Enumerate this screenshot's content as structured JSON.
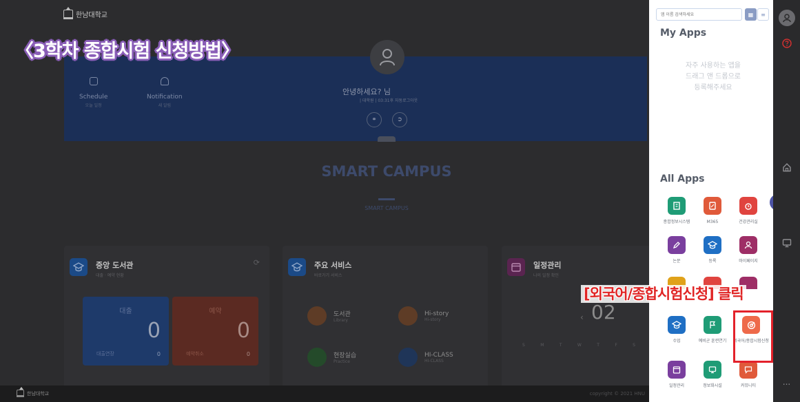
{
  "overlay": {
    "title": "〈3학차 종합시험 신청방법〉",
    "callout": "[외국어/종합시험신청] 클릭"
  },
  "header": {
    "logo_text": "한남대학교"
  },
  "hero": {
    "schedule_label": "Schedule",
    "schedule_sub": "오늘 일정",
    "notification_label": "Notification",
    "notification_sub": "새 알림",
    "greeting": "안녕하세요?         님",
    "greeting_sub": "| 대학원 | 03:31후 자동로그아웃"
  },
  "smart_campus": {
    "title": "SMART CAMPUS",
    "subtitle": "SMART CAMPUS"
  },
  "cards": {
    "library": {
      "title": "중앙 도서관",
      "subtitle": "대출 · 예약 현황",
      "loan_label": "대출",
      "loan_count": "0",
      "loan_foot_label": "대출연장",
      "loan_foot_value": "0",
      "reserve_label": "예약",
      "reserve_count": "0",
      "reserve_foot_label": "예약취소",
      "reserve_foot_value": "0"
    },
    "services": {
      "title": "주요 서비스",
      "subtitle": "바로가기 서비스",
      "items": [
        {
          "label": "도서관",
          "sub": "Library"
        },
        {
          "label": "Hi-story",
          "sub": "Hi-story"
        },
        {
          "label": "현장실습",
          "sub": "Practice"
        },
        {
          "label": "HI-CLASS",
          "sub": "HI-CLASS"
        }
      ]
    },
    "calendar": {
      "title": "일정관리",
      "subtitle": "나의 일정 확인",
      "big_date": "02",
      "weekdays": [
        "S",
        "M",
        "T",
        "W",
        "T",
        "F",
        "S"
      ]
    }
  },
  "footer": {
    "logo_text": "한남대학교",
    "copyright": "copyright © 2021 HNU"
  },
  "panel": {
    "search_placeholder": "앱 이름 검색하세요",
    "my_apps_title": "My Apps",
    "empty_line1": "자주 사용하는 앱을",
    "empty_line2": "드래그 앤 드롭으로",
    "empty_line3": "등록해주세요",
    "all_apps_title": "All Apps",
    "apps": [
      {
        "label": "종합정보시스템",
        "color": "#1f9c76",
        "icon": "building-icon"
      },
      {
        "label": "M365",
        "color": "#e05a3a",
        "icon": "document-icon"
      },
      {
        "label": "건강관리실",
        "color": "#e0443f",
        "icon": "alarm-clock-icon"
      },
      {
        "label": "논문",
        "color": "#7a3f9e",
        "icon": "pencil-icon"
      },
      {
        "label": "등록",
        "color": "#1f6fc4",
        "icon": "graduation-cap-icon"
      },
      {
        "label": "마이페이지",
        "color": "#9e2e66",
        "icon": "person-icon"
      },
      {
        "label": "수업",
        "color": "#1f6fc4",
        "icon": "graduation-cap-icon"
      },
      {
        "label": "예비군 훈련연기",
        "color": "#1f9c76",
        "icon": "flag-icon"
      },
      {
        "label": "외국어/종합시험신청",
        "color": "#ee6a4a",
        "icon": "target-icon"
      },
      {
        "label": "일정관리",
        "color": "#7a3f9e",
        "icon": "calendar-icon"
      },
      {
        "label": "정보화시설",
        "color": "#1f9c76",
        "icon": "monitor-icon"
      },
      {
        "label": "커뮤니티",
        "color": "#e05a3a",
        "icon": "chat-icon"
      }
    ]
  },
  "rail": {
    "more_label": "..."
  }
}
